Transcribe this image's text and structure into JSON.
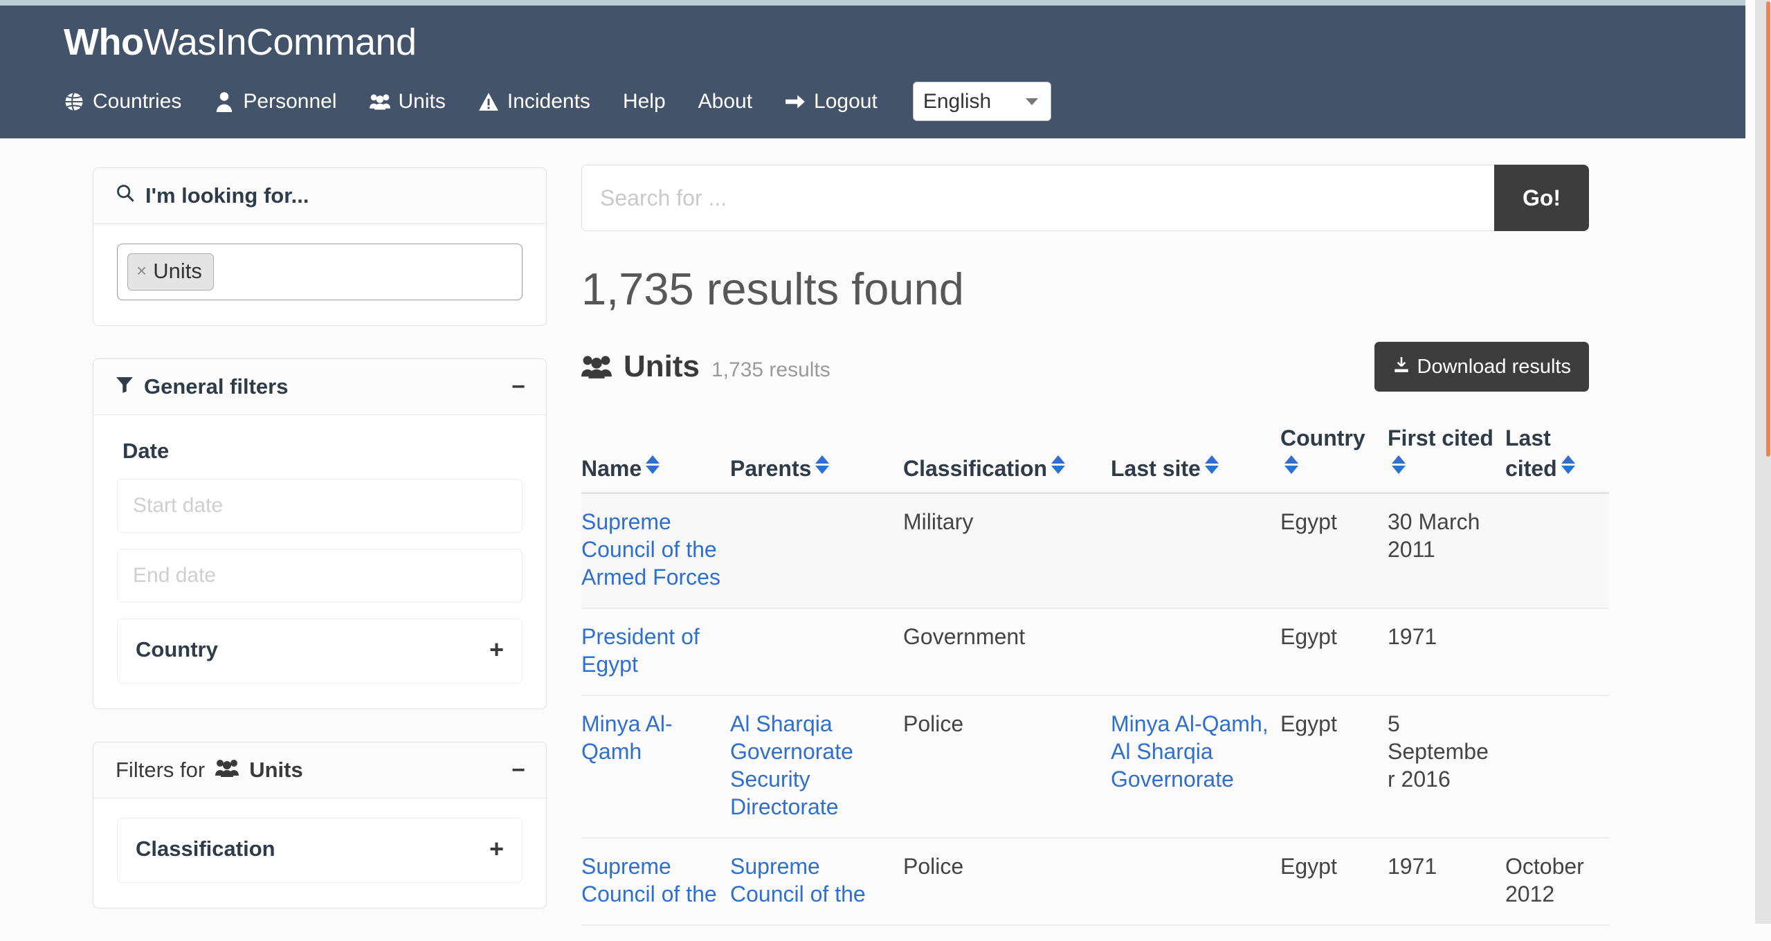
{
  "brand": {
    "bold": "Who",
    "rest": "WasInCommand"
  },
  "nav": {
    "items": [
      {
        "label": "Countries",
        "icon": "globe-icon"
      },
      {
        "label": "Personnel",
        "icon": "person-icon"
      },
      {
        "label": "Units",
        "icon": "users-icon"
      },
      {
        "label": "Incidents",
        "icon": "warning-icon"
      },
      {
        "label": "Help",
        "icon": ""
      },
      {
        "label": "About",
        "icon": ""
      },
      {
        "label": "Logout",
        "icon": "arrow-right-icon"
      }
    ],
    "language": {
      "selected": "English",
      "options": [
        "English"
      ]
    }
  },
  "sidebar": {
    "looking_for": {
      "title": "I'm looking for...",
      "icon": "search-icon",
      "tokens": [
        {
          "label": "Units",
          "remove": "×"
        }
      ]
    },
    "general_filters": {
      "title": "General filters",
      "icon": "filter-icon",
      "toggle": "−",
      "date_label": "Date",
      "start_date": {
        "value": "",
        "placeholder": "Start date"
      },
      "end_date": {
        "value": "",
        "placeholder": "End date"
      },
      "country_accordion": {
        "label": "Country",
        "expand": "+"
      }
    },
    "entity_filters": {
      "title_prefix": "Filters for ",
      "title_entity": "Units",
      "icon": "users-icon",
      "toggle": "−",
      "classification_accordion": {
        "label": "Classification",
        "expand": "+"
      }
    }
  },
  "search": {
    "value": "",
    "placeholder": "Search for ...",
    "button_label": "Go!"
  },
  "results": {
    "headline": "1,735 results found",
    "section_title": "Units",
    "section_count": "1,735 results",
    "section_icon": "users-icon",
    "download_label": "Download results",
    "download_icon": "download-icon",
    "columns": [
      {
        "label": "Name",
        "sortable": true
      },
      {
        "label": "Parents",
        "sortable": true
      },
      {
        "label": "Classification",
        "sortable": true
      },
      {
        "label": "Last site",
        "sortable": true
      },
      {
        "label": "Country",
        "sortable": true
      },
      {
        "label": "First cited",
        "sortable": true
      },
      {
        "label": "Last cited",
        "sortable": true
      }
    ],
    "rows": [
      {
        "name": "Supreme Council of the Armed Forces",
        "name_link": true,
        "parents": "",
        "parents_link": false,
        "classification": "Military",
        "last_site": "",
        "last_site_link": false,
        "country": "Egypt",
        "first_cited": "30 March 2011",
        "last_cited": "",
        "shaded": true
      },
      {
        "name": "President of Egypt",
        "name_link": true,
        "parents": "",
        "parents_link": false,
        "classification": "Government",
        "last_site": "",
        "last_site_link": false,
        "country": "Egypt",
        "first_cited": "1971",
        "last_cited": "",
        "shaded": false
      },
      {
        "name": "Minya Al-Qamh",
        "name_link": true,
        "parents": "Al Sharqia Governorate Security Directorate",
        "parents_link": true,
        "classification": "Police",
        "last_site": "Minya Al-Qamh, Al Sharqia Governorate",
        "last_site_link": true,
        "country": "Egypt",
        "first_cited": "5 September 2016",
        "last_cited": "",
        "shaded": false
      },
      {
        "name": "Supreme Council of the",
        "name_link": true,
        "parents": "Supreme Council of the",
        "parents_link": true,
        "classification": "Police",
        "last_site": "",
        "last_site_link": false,
        "country": "Egypt",
        "first_cited": "1971",
        "last_cited": "October 2012",
        "shaded": false
      }
    ]
  },
  "colors": {
    "navbar": "#42536a",
    "top_strip": "#bccdd4",
    "link": "#2f6fd0",
    "dark_button": "#3d3d3d",
    "page_bg": "#fbfbfb",
    "scrollbar_thumb": "#e8855c"
  }
}
